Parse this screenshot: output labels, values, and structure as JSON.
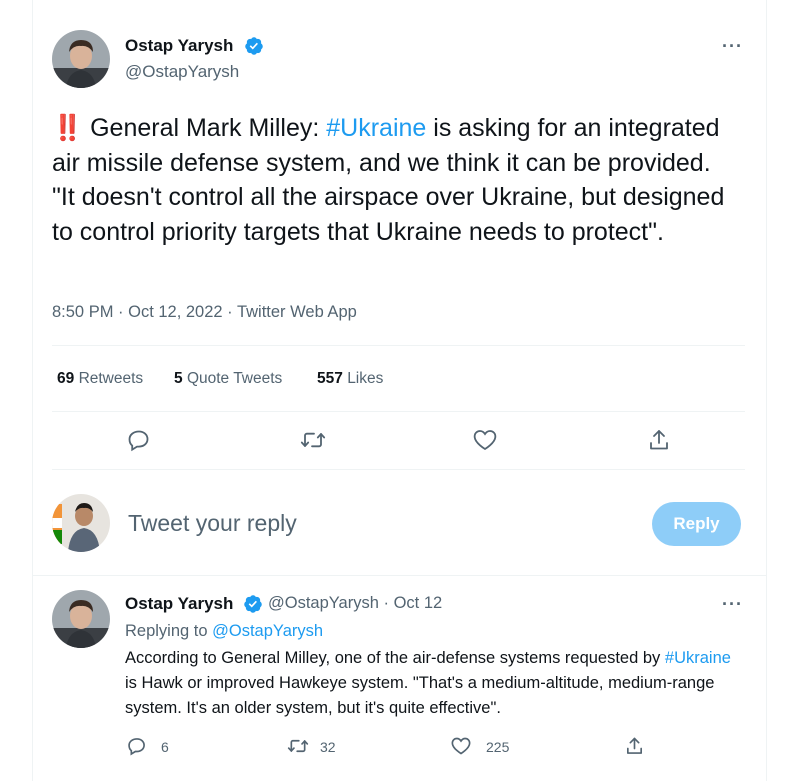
{
  "main_tweet": {
    "author_name": "Ostap Yarysh",
    "author_handle": "@OstapYarysh",
    "alert_emoji": "‼️",
    "text_part1": "General Mark Milley: ",
    "hashtag": "#Ukraine",
    "text_part2": " is asking for an integrated air missile defense system, and we think it can be provided. \"It doesn't control all the airspace over Ukraine, but designed to control priority targets that Ukraine needs to protect\".",
    "timestamp": "8:50 PM · Oct 12, 2022 · Twitter Web App",
    "stats": {
      "retweets_count": "69",
      "retweets_label": "Retweets",
      "quotes_count": "5",
      "quotes_label": "Quote Tweets",
      "likes_count": "557",
      "likes_label": "Likes"
    }
  },
  "composer": {
    "placeholder": "Tweet your reply",
    "button_label": "Reply"
  },
  "reply_tweet": {
    "author_name": "Ostap Yarysh",
    "author_handle_time": "@OstapYarysh · Oct 12",
    "replying_prefix": "Replying to ",
    "replying_handle": "@OstapYarysh",
    "text_part1": "According to General Milley, one of the air-defense systems requested by ",
    "hashtag": "#Ukraine",
    "text_part2": " is Hawk or improved Hawkeye system. \"That's a medium-altitude, medium-range system. It's an older system, but it's quite effective\".",
    "reply_count": "6",
    "retweet_count": "32",
    "like_count": "225"
  },
  "colors": {
    "accent": "#1d9bf0",
    "reply_button_disabled": "#8ecdf8",
    "secondary_text": "#536471",
    "alert_red": "#be1931"
  },
  "icons": [
    "verified-badge-icon",
    "more-options-icon",
    "reply-icon",
    "retweet-icon",
    "like-icon",
    "share-icon"
  ]
}
